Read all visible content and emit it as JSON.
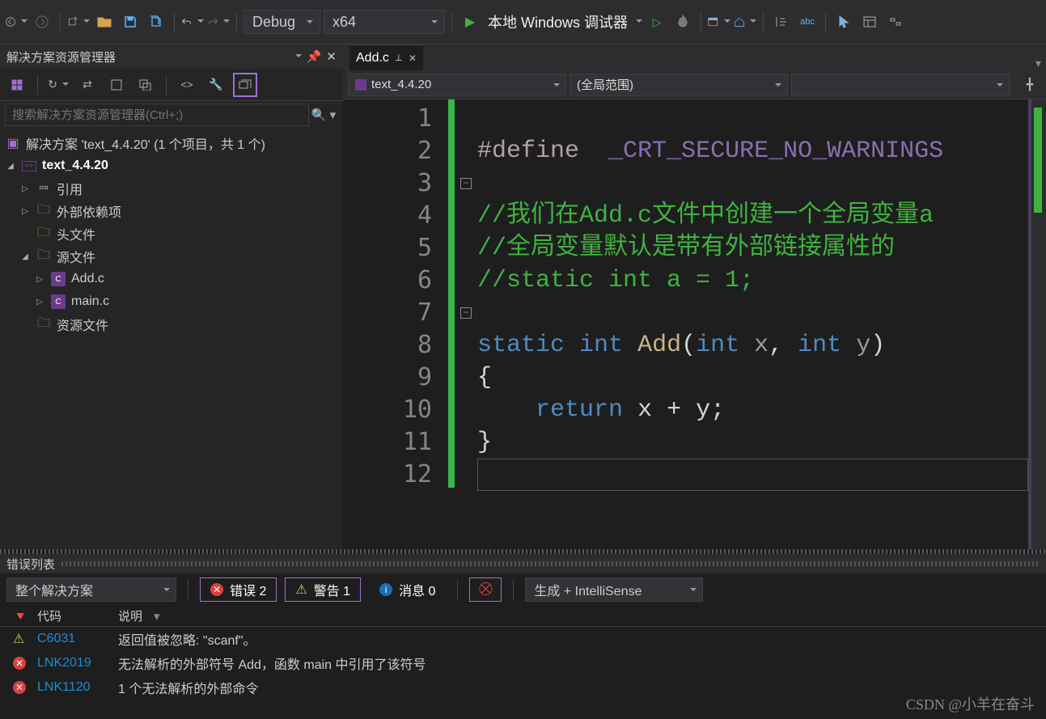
{
  "toolbar": {
    "config_label": "Debug",
    "platform_label": "x64",
    "debugger_label": "本地 Windows 调试器"
  },
  "solution_explorer": {
    "title": "解决方案资源管理器",
    "search_placeholder": "搜索解决方案资源管理器(Ctrl+;)",
    "root": "解决方案 'text_4.4.20' (1 个项目，共 1 个)",
    "project": "text_4.4.20",
    "nodes": {
      "refs": "引用",
      "ext_deps": "外部依赖项",
      "headers": "头文件",
      "sources": "源文件",
      "file_add": "Add.c",
      "file_main": "main.c",
      "resources": "资源文件"
    }
  },
  "editor": {
    "tab_name": "Add.c",
    "drop_project": "text_4.4.20",
    "drop_scope": "(全局范围)",
    "line_numbers": [
      "1",
      "2",
      "3",
      "4",
      "5",
      "6",
      "7",
      "8",
      "9",
      "10",
      "11",
      "12"
    ],
    "code": {
      "l1_define": "#define",
      "l1_macro": "_CRT_SECURE_NO_WARNINGS",
      "l3": "//我们在Add.c文件中创建一个全局变量a",
      "l4": "//全局变量默认是带有外部链接属性的",
      "l5": "//static int a = 1;",
      "l7_static": "static",
      "l7_int1": "int",
      "l7_fn": "Add",
      "l7_int2": "int",
      "l7_x": "x",
      "l7_int3": "int",
      "l7_y": "y",
      "l8": "{",
      "l9_return": "return",
      "l9_expr": "x + y;",
      "l10": "}"
    }
  },
  "error_list": {
    "title": "错误列表",
    "scope": "整个解决方案",
    "errors_label": "错误 2",
    "warnings_label": "警告 1",
    "messages_label": "消息 0",
    "source_label": "生成 + IntelliSense",
    "columns": {
      "code": "代码",
      "desc": "说明"
    },
    "rows": [
      {
        "type": "warn",
        "code": "C6031",
        "desc": "返回值被忽略: \"scanf\"。"
      },
      {
        "type": "error",
        "code": "LNK2019",
        "desc": "无法解析的外部符号 Add，函数 main 中引用了该符号"
      },
      {
        "type": "error",
        "code": "LNK1120",
        "desc": "1 个无法解析的外部命令"
      }
    ]
  },
  "watermark": "CSDN @小羊在奋斗"
}
